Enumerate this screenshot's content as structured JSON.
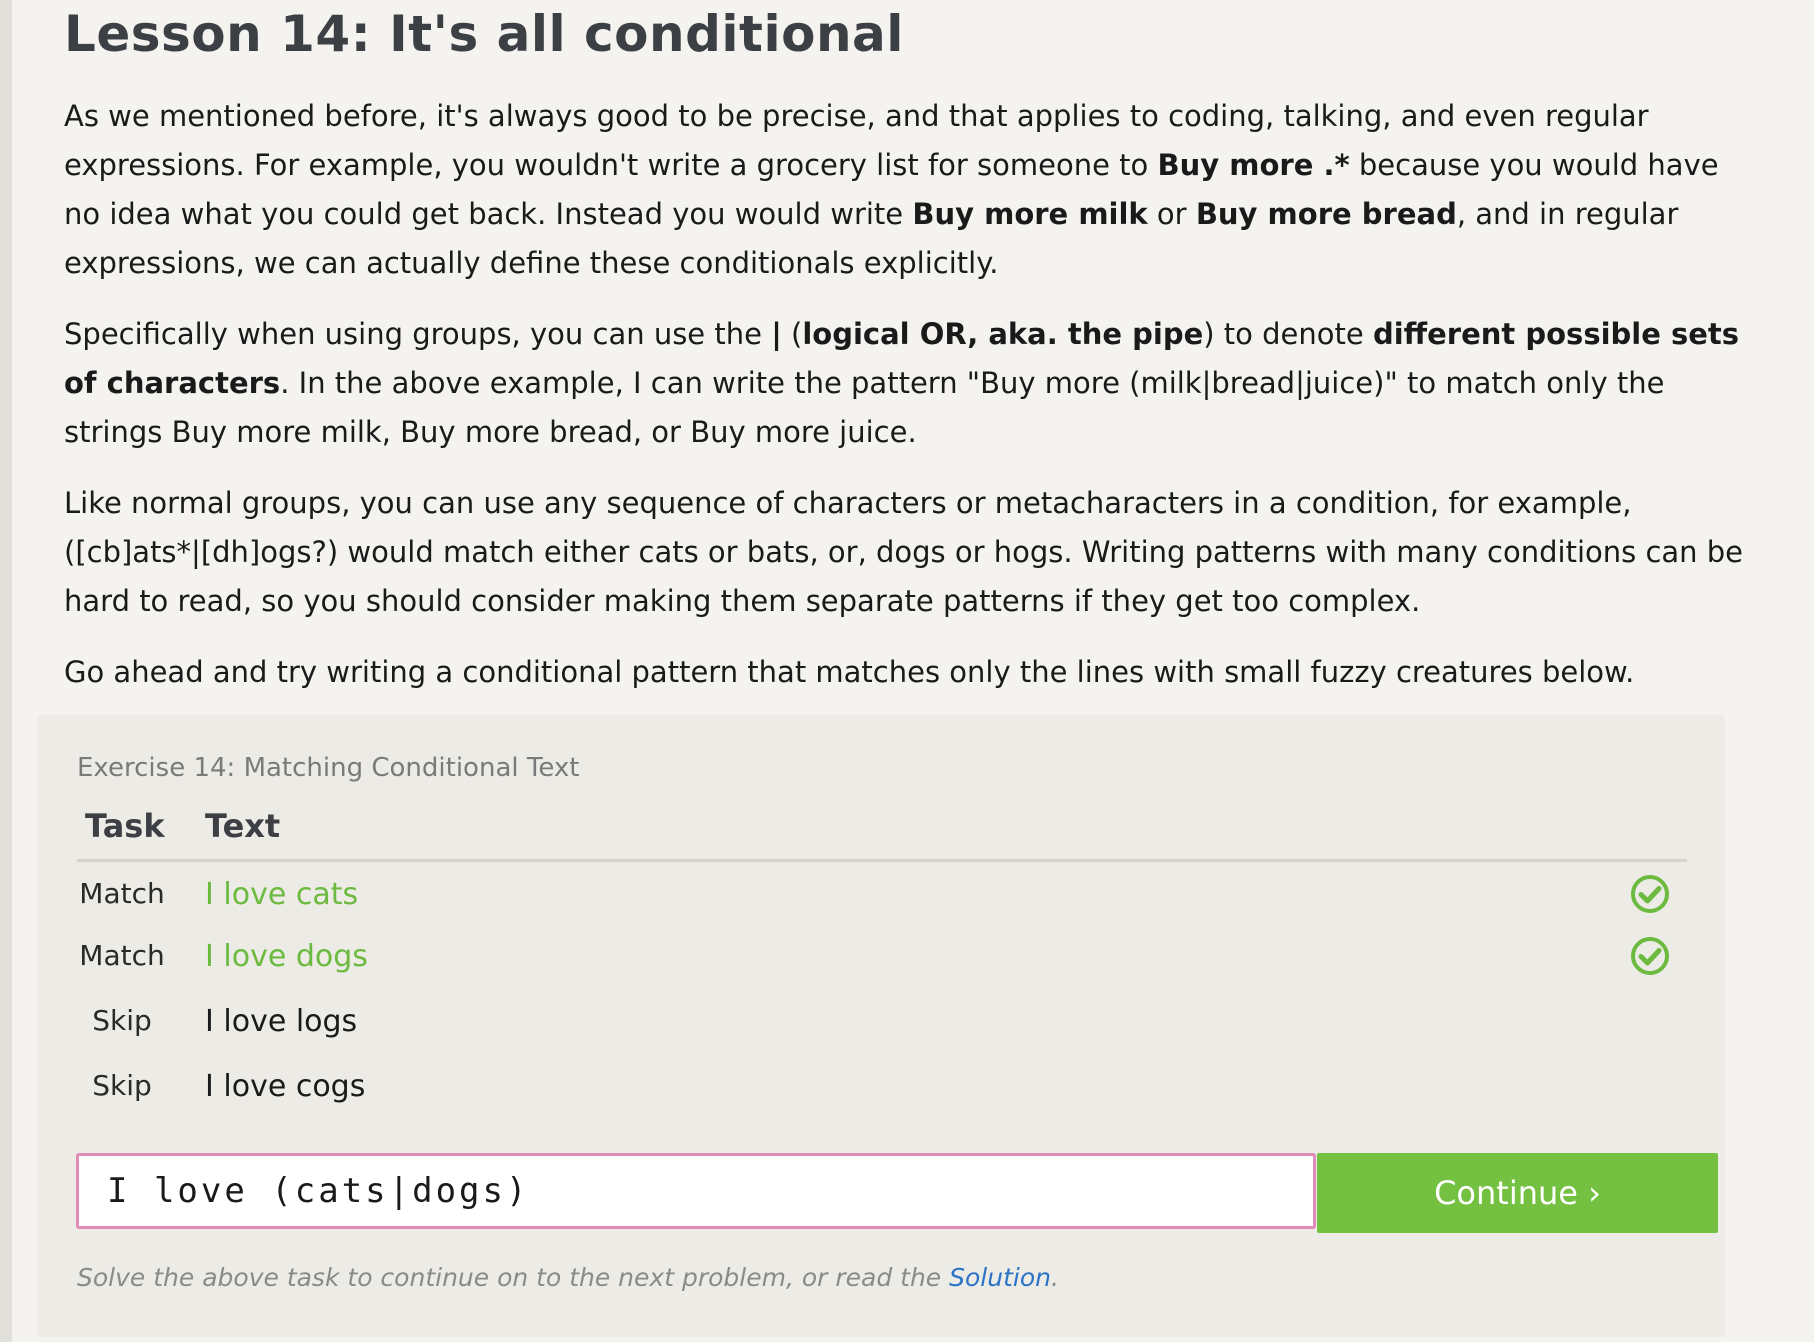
{
  "lesson": {
    "title": "Lesson 14: It's all conditional",
    "paragraphs": [
      [
        {
          "t": "As we mentioned before, it's always good to be precise, and that applies to coding, talking, and even regular expressions. For example, you wouldn't write a grocery list for someone to "
        },
        {
          "t": "Buy more .*",
          "b": true
        },
        {
          "t": " because you would have no idea what you could get back. Instead you would write "
        },
        {
          "t": "Buy more milk",
          "b": true
        },
        {
          "t": " or "
        },
        {
          "t": "Buy more bread",
          "b": true
        },
        {
          "t": ", and in regular expressions, we can actually define these conditionals explicitly."
        }
      ],
      [
        {
          "t": "Specifically when using groups, you can use the "
        },
        {
          "t": "|",
          "b": true
        },
        {
          "t": " ("
        },
        {
          "t": "logical OR, aka. the pipe",
          "b": true
        },
        {
          "t": ") to denote "
        },
        {
          "t": "different possible sets of characters",
          "b": true
        },
        {
          "t": ". In the above example, I can write the pattern \"Buy more (milk|bread|juice)\" to match only the strings Buy more milk, Buy more bread, or Buy more juice."
        }
      ],
      [
        {
          "t": "Like normal groups, you can use any sequence of characters or metacharacters in a condition, for example, ([cb]ats*|[dh]ogs?) would match either cats or bats, or, dogs or hogs. Writing patterns with many conditions can be hard to read, so you should consider making them separate patterns if they get too complex."
        }
      ],
      [
        {
          "t": "Go ahead and try writing a conditional pattern that matches only the lines with small fuzzy creatures below."
        }
      ]
    ]
  },
  "exercise": {
    "title": "Exercise 14: Matching Conditional Text",
    "columns": {
      "task": "Task",
      "text": "Text"
    },
    "rows": [
      {
        "task": "Match",
        "text": "I love cats",
        "status": "matched"
      },
      {
        "task": "Match",
        "text": "I love dogs",
        "status": "matched"
      },
      {
        "task": "Skip",
        "text": "I love logs",
        "status": "none"
      },
      {
        "task": "Skip",
        "text": "I love cogs",
        "status": "none"
      }
    ],
    "input_value": "I love (cats|dogs)",
    "continue_label": "Continue ›",
    "hint_prefix": "Solve the above task to continue on to the next problem, or read the ",
    "hint_link": "Solution",
    "hint_suffix": ".",
    "colors": {
      "match_green": "#6cba3f",
      "button_green": "#74c041",
      "input_border": "#e18cb7",
      "link_blue": "#2a73c7"
    }
  }
}
